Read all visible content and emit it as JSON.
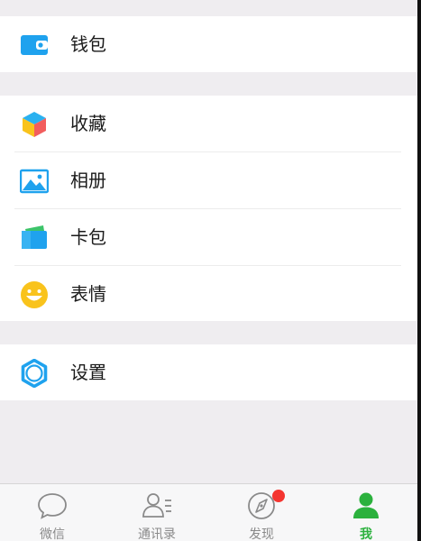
{
  "menu": {
    "wallet": {
      "label": "钱包",
      "icon": "wallet-icon"
    },
    "favorites": {
      "label": "收藏",
      "icon": "cube-icon"
    },
    "album": {
      "label": "相册",
      "icon": "picture-icon"
    },
    "card_pack": {
      "label": "卡包",
      "icon": "card-icon"
    },
    "stickers": {
      "label": "表情",
      "icon": "smiley-icon"
    },
    "settings": {
      "label": "设置",
      "icon": "gear-icon"
    }
  },
  "tabbar": {
    "tabs": [
      {
        "label": "微信",
        "icon": "chat-bubble-icon",
        "active": false
      },
      {
        "label": "通讯录",
        "icon": "contacts-icon",
        "active": false
      },
      {
        "label": "发现",
        "icon": "compass-icon",
        "active": false,
        "badge": true
      },
      {
        "label": "我",
        "icon": "person-icon",
        "active": true
      }
    ]
  },
  "colors": {
    "accent_green": "#2bb13d",
    "badge_red": "#f43530",
    "icon_blue": "#1fa2ee",
    "smiley_yellow": "#f9c31c"
  }
}
